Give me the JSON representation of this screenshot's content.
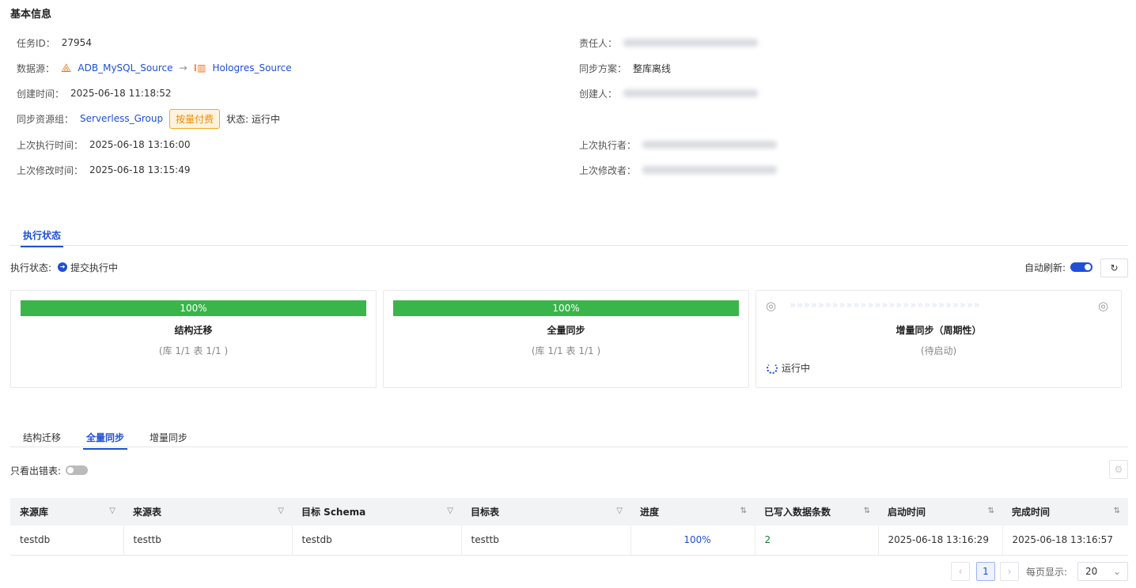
{
  "title": "基本信息",
  "info_left": [
    {
      "label": "任务ID：",
      "value": "27954"
    },
    {
      "label": "数据源：",
      "source": "ADB_MySQL_Source",
      "arrow": "→",
      "target": "Hologres_Source"
    },
    {
      "label": "创建时间：",
      "value": "2025-06-18 11:18:52"
    },
    {
      "label": "同步资源组：",
      "group": "Serverless_Group",
      "badge": "按量付费",
      "status": "状态: 运行中"
    },
    {
      "label": "上次执行时间：",
      "value": "2025-06-18 13:16:00"
    },
    {
      "label": "上次修改时间：",
      "value": "2025-06-18 13:15:49"
    }
  ],
  "info_right": [
    {
      "label": "责任人："
    },
    {
      "label": "同步方案：",
      "value": "整库离线"
    },
    {
      "label": "创建人："
    },
    {
      "label": "上次执行者："
    },
    {
      "label": "上次修改者："
    }
  ],
  "exec_tab": "执行状态",
  "exec_status_label": "执行状态:",
  "exec_status": "提交执行中",
  "auto_refresh": "自动刷新:",
  "auto_refresh_on": true,
  "cards": [
    {
      "progress": "100%",
      "title": "结构迁移",
      "sub": "(库 1/1 表 1/1 )"
    },
    {
      "progress": "100%",
      "title": "全量同步",
      "sub": "(库 1/1 表 1/1 )"
    },
    {
      "title": "增量同步（周期性）",
      "sub": "(待启动)",
      "state": "运行中"
    }
  ],
  "sub_tabs": [
    "结构迁移",
    "全量同步",
    "增量同步"
  ],
  "active_sub_tab": 1,
  "error_only": "只看出错表:",
  "columns": [
    "来源库",
    "来源表",
    "目标 Schema",
    "目标表",
    "进度",
    "已写入数据条数",
    "启动时间",
    "完成时间"
  ],
  "rows": [
    [
      "testdb",
      "testtb",
      "testdb",
      "testtb",
      "100%",
      "2",
      "2025-06-18 13:16:29",
      "2025-06-18 13:16:57"
    ]
  ],
  "pagination": {
    "prev": "‹",
    "page": "1",
    "next": "›",
    "per_page_label": "每页显示:",
    "per_page": "20"
  },
  "colors": {
    "accent": "#1e4fd6",
    "success": "#39b54a",
    "badge": "#f08c00"
  }
}
